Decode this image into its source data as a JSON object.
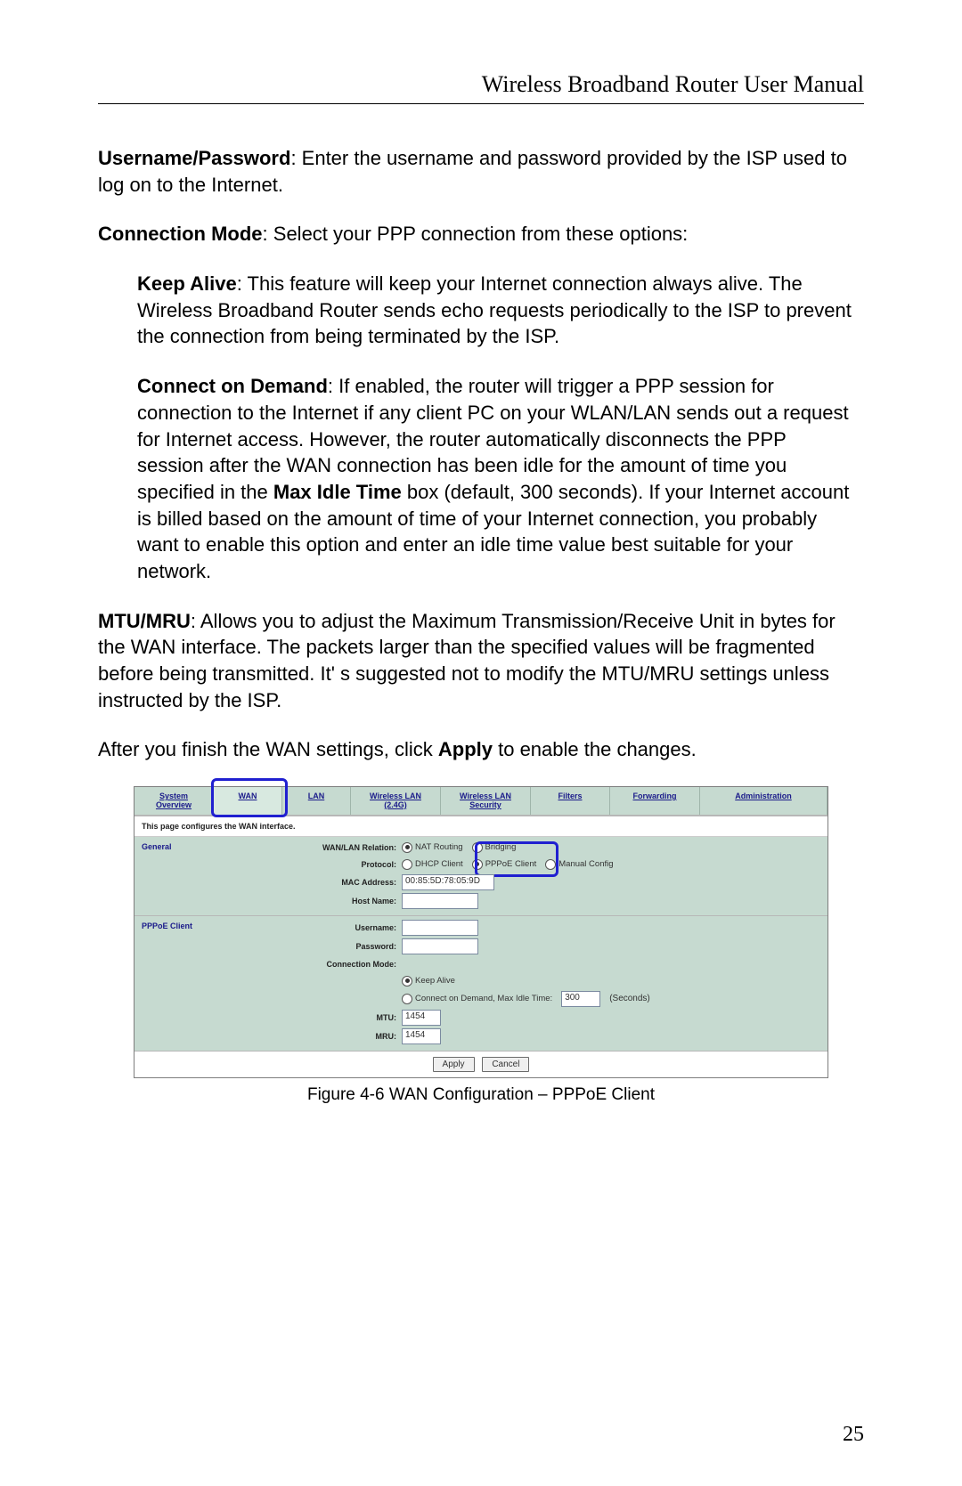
{
  "header": {
    "title": "Wireless Broadband Router User Manual"
  },
  "manual": {
    "userpass_label": "Username/Password",
    "userpass_text": ": Enter the username and password provided by the ISP used to log on to the Internet.",
    "connmode_label": "Connection Mode",
    "connmode_text": ": Select your PPP connection from these options:",
    "keepalive_label": "Keep Alive",
    "keepalive_text": ": This feature will keep your Internet connection always alive. The Wireless Broadband Router sends echo requests periodically to the ISP to prevent the connection from being terminated by the ISP.",
    "demand_label": "Connect on Demand",
    "demand_pre": ": If enabled, the router will trigger a PPP session for connection to the Internet if any client PC on your WLAN/LAN sends out a request for Internet access. However, the router automatically disconnects the PPP session after the WAN connection has been idle for the amount of time you specified in the ",
    "demand_bold": "Max Idle Time",
    "demand_post": " box (default, 300 seconds). If your Internet account is billed based on the amount of time of your Internet connection, you probably want to enable this option and enter an idle time value best suitable for your network.",
    "mtu_label": "MTU/MRU",
    "mtu_text": ": Allows you to adjust the Maximum Transmission/Receive Unit in bytes for the WAN interface. The packets larger than the specified values will be fragmented before being transmitted. It' s suggested not to modify the MTU/MRU settings unless instructed by the ISP.",
    "apply_pre": "After you finish the WAN settings, click ",
    "apply_bold": "Apply",
    "apply_post": " to enable the changes."
  },
  "tabs": {
    "t0": "System\nOverview",
    "t1": "WAN",
    "t2": "LAN",
    "t3": "Wireless LAN\n(2.4G)",
    "t4": "Wireless LAN\nSecurity",
    "t5": "Filters",
    "t6": "Forwarding",
    "t7": "Administration"
  },
  "shot": {
    "desc": "This page configures the WAN interface.",
    "general": {
      "title": "General",
      "row1_label": "WAN/LAN Relation:",
      "row1_opt1": "NAT Routing",
      "row1_opt2": "Bridging",
      "row2_label": "Protocol:",
      "row2_opt1": "DHCP Client",
      "row2_opt2": "PPPoE Client",
      "row2_opt3": "Manual Config",
      "row3_label": "MAC Address:",
      "row3_val": "00:85:5D:78:05:9D",
      "row4_label": "Host Name:"
    },
    "pppoe": {
      "title": "PPPoE Client",
      "user_label": "Username:",
      "pass_label": "Password:",
      "conn_label": "Connection Mode:",
      "keep": "Keep Alive",
      "demand": "Connect on Demand, Max Idle Time:",
      "demand_val": "300",
      "demand_unit": "(Seconds)",
      "mtu_label": "MTU:",
      "mtu_val": "1454",
      "mru_label": "MRU:",
      "mru_val": "1454"
    },
    "buttons": {
      "apply": "Apply",
      "cancel": "Cancel"
    }
  },
  "caption": "Figure 4-6  WAN Configuration – PPPoE Client",
  "page_number": "25"
}
